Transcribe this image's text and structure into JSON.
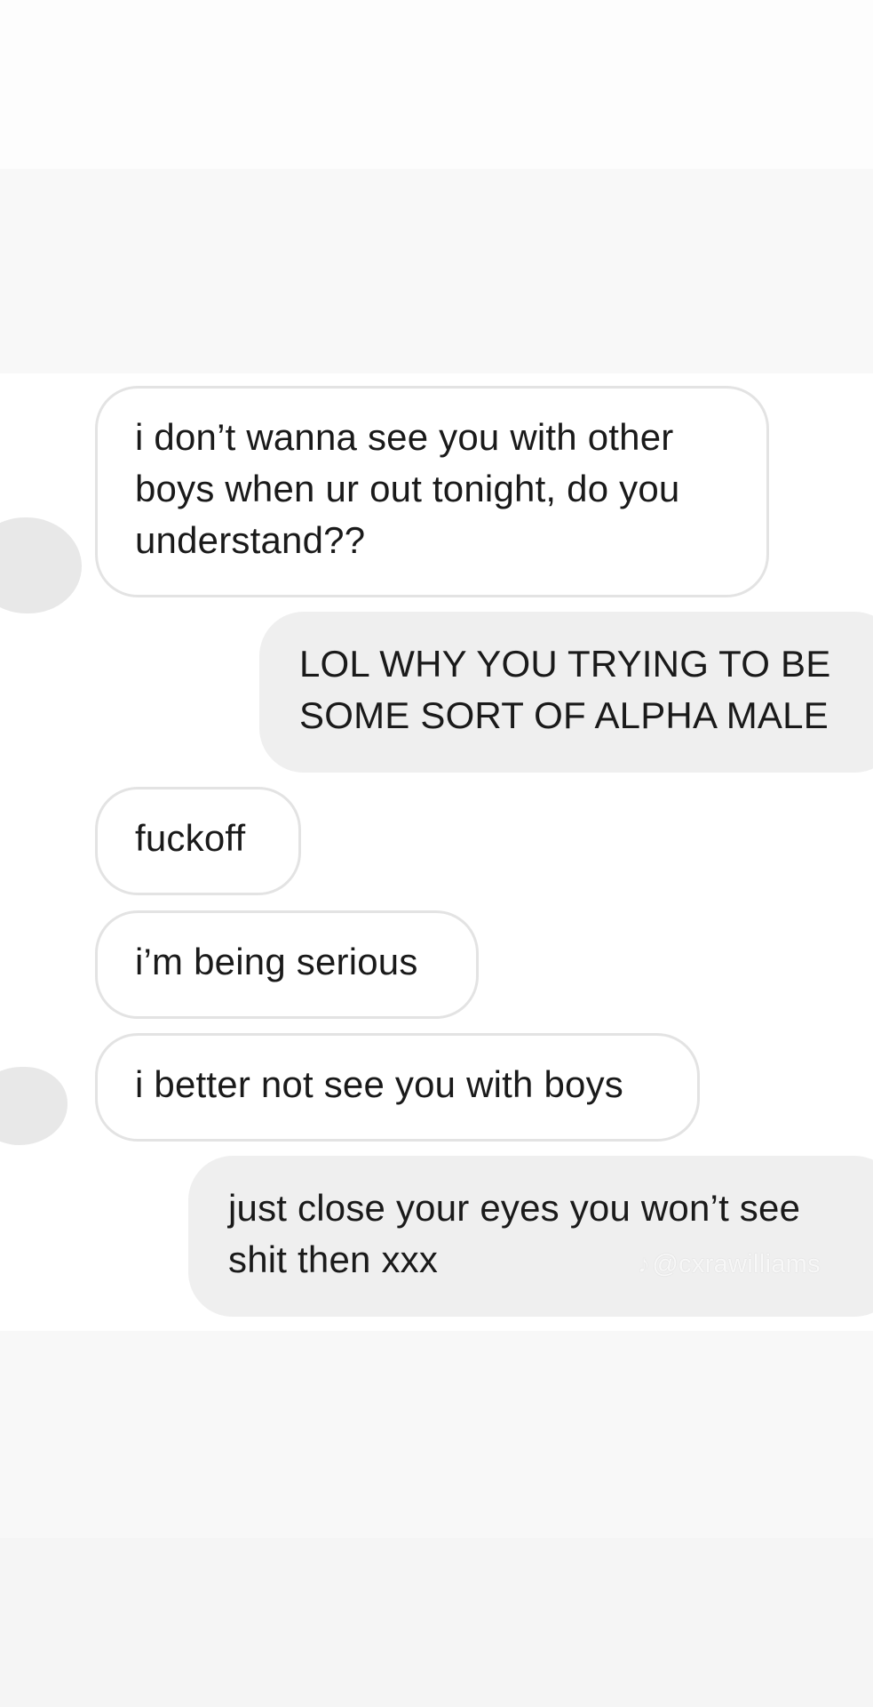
{
  "messages": [
    {
      "sender": "them",
      "text": "i don’t wanna see you with other\nboys when ur out tonight, do you\nunderstand??"
    },
    {
      "sender": "me",
      "text": "LOL WHY YOU TRYING TO BE\nSOME SORT OF ALPHA MALE"
    },
    {
      "sender": "them",
      "text": "fuckoff"
    },
    {
      "sender": "them",
      "text": "i’m being serious"
    },
    {
      "sender": "them",
      "text": "i better not see you with boys"
    },
    {
      "sender": "me",
      "text": "just close your eyes you won’t see\nshit then xxx"
    }
  ],
  "watermark": {
    "icon": "tiktok-note-icon",
    "handle": "@cxrawilliams"
  },
  "colors": {
    "incoming_bubble_bg": "#ffffff",
    "incoming_bubble_border": "#e3e3e3",
    "outgoing_bubble_bg": "#efefef",
    "avatar_placeholder": "#e8e8e8"
  }
}
